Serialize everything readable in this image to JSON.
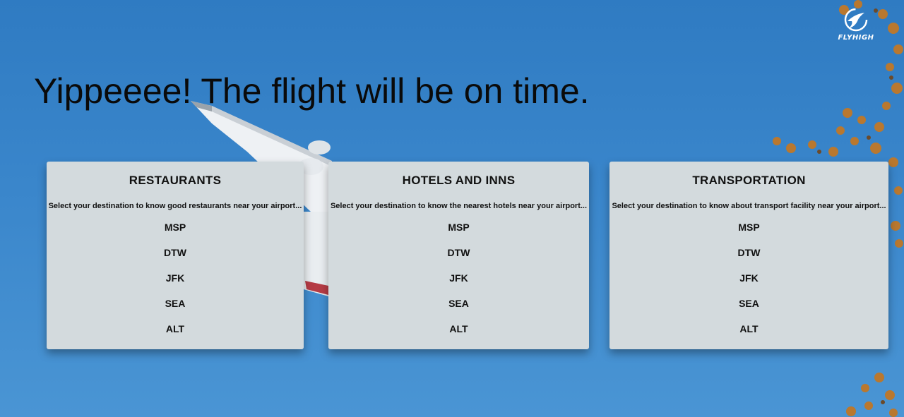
{
  "brand": {
    "logo_text": "FLYHIGH"
  },
  "headline": "Yippeeee! The flight will be on time.",
  "cards": [
    {
      "title": "RESTAURANTS",
      "description": "Select your destination to know good restaurants near your airport...",
      "airports": [
        "MSP",
        "DTW",
        "JFK",
        "SEA",
        "ALT"
      ]
    },
    {
      "title": "HOTELS AND INNS",
      "description": "Select your destination to know the nearest hotels near your airport...",
      "airports": [
        "MSP",
        "DTW",
        "JFK",
        "SEA",
        "ALT"
      ]
    },
    {
      "title": "TRANSPORTATION",
      "description": "Select your destination to know about transport facility near your airport...",
      "airports": [
        "MSP",
        "DTW",
        "JFK",
        "SEA",
        "ALT"
      ]
    }
  ],
  "colors": {
    "sky": "#3a86cb",
    "card_background": "#d3dadd",
    "text": "#111111"
  }
}
